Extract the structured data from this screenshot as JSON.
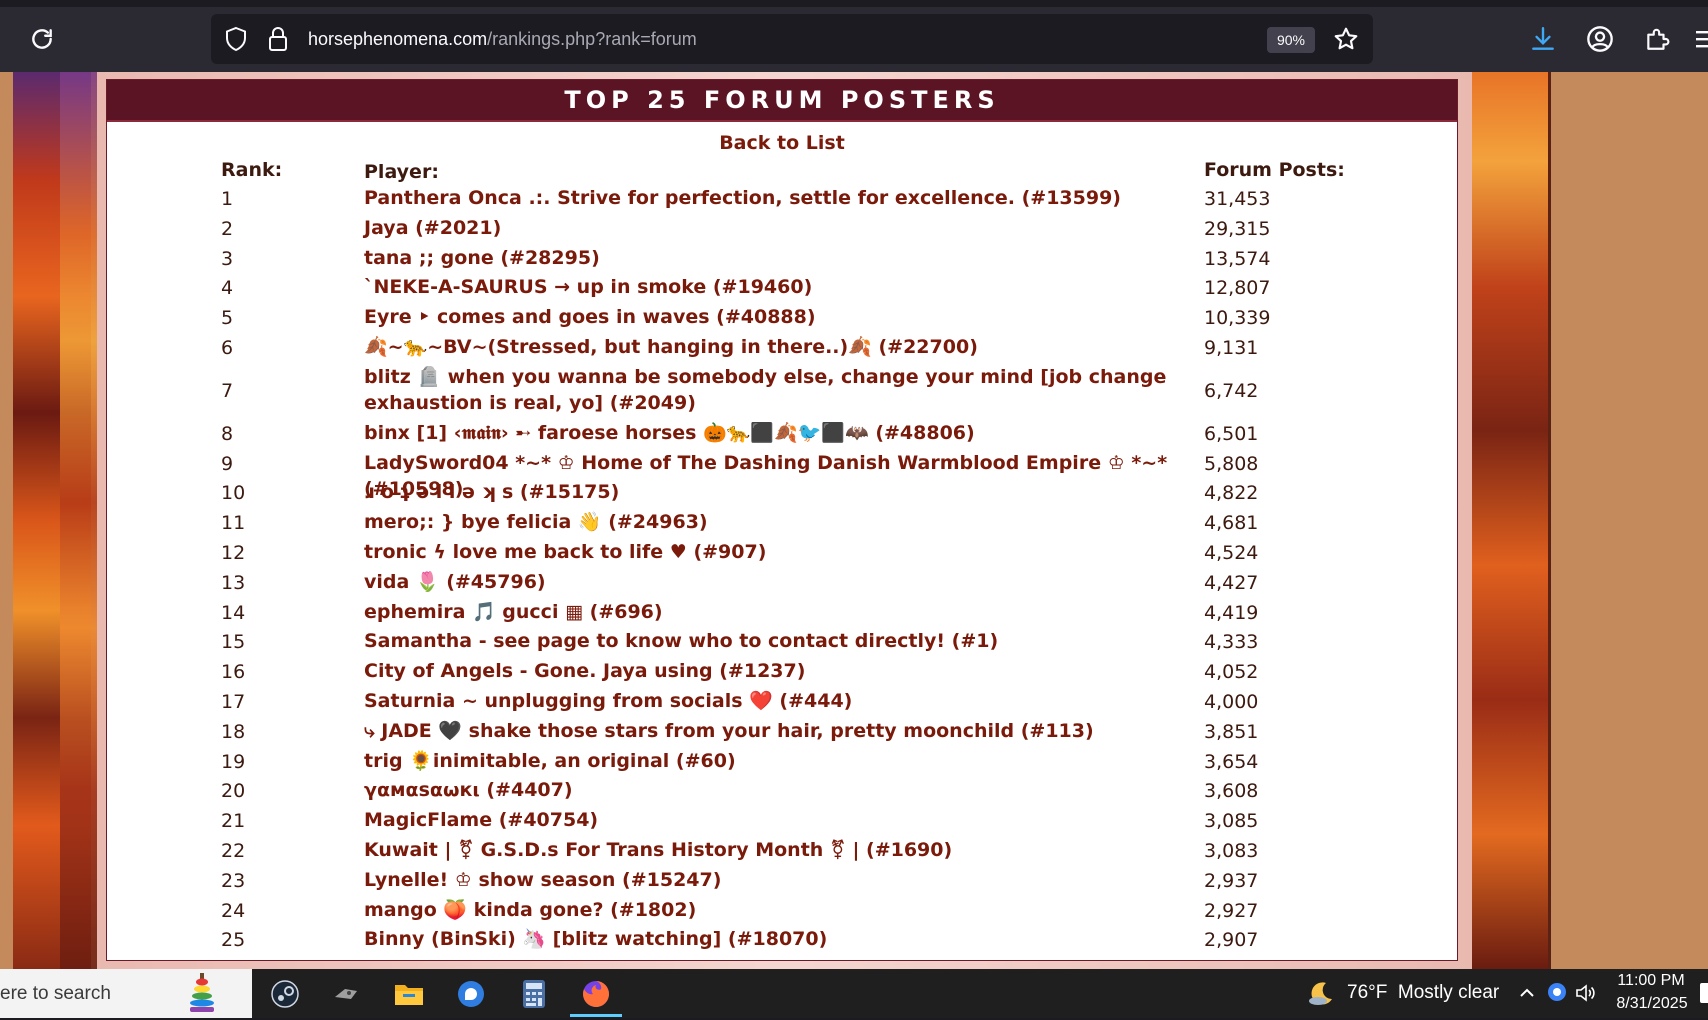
{
  "browser": {
    "url_domain": "horsephenomena.com",
    "url_path": "/rankings.php?rank=forum",
    "zoom": "90%"
  },
  "page": {
    "title": "TOP 25 FORUM POSTERS",
    "back_link": "Back to List",
    "headers": {
      "rank": "Rank:",
      "player": "Player:",
      "posts": "Forum Posts:"
    },
    "rows": [
      {
        "rank": "1",
        "player": "Panthera Onca .:. Strive for perfection, settle for excellence. (#13599)",
        "posts": "31,453"
      },
      {
        "rank": "2",
        "player": "Jaya (#2021)",
        "posts": "29,315"
      },
      {
        "rank": "3",
        "player": "tana ;; gone (#28295)",
        "posts": "13,574"
      },
      {
        "rank": "4",
        "player": "`NEKE-A-SAURUS → up in smoke (#19460)",
        "posts": "12,807"
      },
      {
        "rank": "5",
        "player": "Eyre ‣ comes and goes in waves (#40888)",
        "posts": "10,339"
      },
      {
        "rank": "6",
        "player": "🍂~🐆~BV~(Stressed, but hanging in there..)🍂 (#22700)",
        "posts": "9,131"
      },
      {
        "rank": "7",
        "player": "blitz 🪦 when you wanna be somebody else, change your mind [job change exhaustion is real, yo] (#2049)",
        "posts": "6,742"
      },
      {
        "rank": "8",
        "player": "binx [1] ‹𝖒𝖆𝖎𝖓› ➸ faroese horses 🎃🐆⬛🍂🐦⬛🦇 (#48806)",
        "posts": "6,501"
      },
      {
        "rank": "9",
        "player": "LadySword04 *~* ♔ Home of The Dashing Danish Warmblood Empire ♔ *~* (#10598)",
        "posts": "5,808"
      },
      {
        "rank": "10",
        "player": "ɹ o ʇ ə l l ə ʞ s (#15175)",
        "posts": "4,822"
      },
      {
        "rank": "11",
        "player": "mero;: } bye felicia 👋 (#24963)",
        "posts": "4,681"
      },
      {
        "rank": "12",
        "player": "tronic ϟ love me back to life ♥ (#907)",
        "posts": "4,524"
      },
      {
        "rank": "13",
        "player": "vida 🌷 (#45796)",
        "posts": "4,427"
      },
      {
        "rank": "14",
        "player": "ephemira 🎵 gucci ▦ (#696)",
        "posts": "4,419"
      },
      {
        "rank": "15",
        "player": "Samantha - see page to know who to contact directly! (#1)",
        "posts": "4,333"
      },
      {
        "rank": "16",
        "player": "City of Angels - Gone. Jaya using (#1237)",
        "posts": "4,052"
      },
      {
        "rank": "17",
        "player": "Saturnia ~ unplugging from socials ❤️ (#444)",
        "posts": "4,000"
      },
      {
        "rank": "18",
        "player": "⤷ JADE 🖤 shake those stars from your hair, pretty moonchild (#113)",
        "posts": "3,851"
      },
      {
        "rank": "19",
        "player": "trig 🌻inimitable, an original (#60)",
        "posts": "3,654"
      },
      {
        "rank": "20",
        "player": "γαмαѕαωкι (#4407)",
        "posts": "3,608"
      },
      {
        "rank": "21",
        "player": "MagicFlame (#40754)",
        "posts": "3,085"
      },
      {
        "rank": "22",
        "player": "Kuwait | ⚧ G.S.D.s For Trans History Month ⚧ | (#1690)",
        "posts": "3,083"
      },
      {
        "rank": "23",
        "player": "Lynelle! ♔ show season (#15247)",
        "posts": "2,937"
      },
      {
        "rank": "24",
        "player": "mango 🍑 kinda gone? (#1802)",
        "posts": "2,927"
      },
      {
        "rank": "25",
        "player": "Binny (BinSki) 🦄 [blitz watching] (#18070)",
        "posts": "2,907"
      }
    ]
  },
  "taskbar": {
    "search_text": "ere to search",
    "weather": "76°F  Mostly clear",
    "time": "11:00 PM",
    "date": "8/31/2025"
  },
  "icons": [
    "reload-icon",
    "shield-icon",
    "lock-icon",
    "star-icon",
    "download-icon",
    "account-icon",
    "extensions-icon",
    "menu-icon"
  ]
}
